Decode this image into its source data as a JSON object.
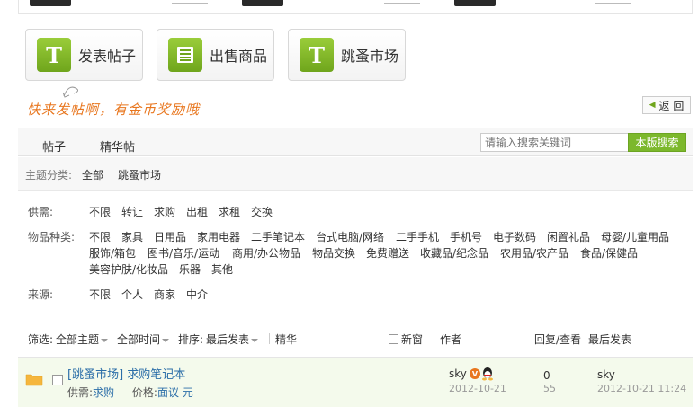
{
  "actions": {
    "post": "发表帖子",
    "sell": "出售商品",
    "market": "跳蚤市场"
  },
  "slogan": "快来发帖啊，有金币奖励哦",
  "back_label": "返 回",
  "tabs": [
    "帖子",
    "精华帖"
  ],
  "search": {
    "placeholder": "请输入搜索关键词",
    "button": "本版搜索"
  },
  "category": {
    "label": "主题分类:",
    "items": [
      "全部",
      "跳蚤市场"
    ]
  },
  "filters": {
    "supply": {
      "label": "供需:",
      "options": [
        "不限",
        "转让",
        "求购",
        "出租",
        "求租",
        "交换"
      ]
    },
    "goods": {
      "label": "物品种类:",
      "row1": [
        "不限",
        "家具",
        "日用品",
        "家用电器",
        "二手笔记本",
        "台式电脑/网络",
        "二手手机",
        "手机号",
        "电子数码",
        "闲置礼品",
        "母婴/儿童用品"
      ],
      "row2": [
        "服饰/箱包",
        "图书/音乐/运动",
        "商用/办公物品",
        "物品交换",
        "免费赠送",
        "收藏品/纪念品",
        "农用品/农产品",
        "食品/保健品"
      ],
      "row3": [
        "美容护肤/化妆品",
        "乐器",
        "其他"
      ]
    },
    "source": {
      "label": "来源:",
      "options": [
        "不限",
        "个人",
        "商家",
        "中介"
      ]
    }
  },
  "list_header": {
    "filter": "筛选:",
    "all_topics": "全部主题",
    "all_time": "全部时间",
    "sort": "排序:",
    "latest": "最后发表",
    "digest": "精华",
    "new_window": "新窗",
    "author": "作者",
    "reply_view": "回复/查看",
    "last_post": "最后发表"
  },
  "threads": [
    {
      "board": "[跳蚤市场]",
      "title": "求购笔记本",
      "supply_label": "供需:",
      "supply_value": "求购",
      "price_label": "价格:",
      "price_value": "面议 元",
      "author": "sky",
      "date": "2012-10-21",
      "replies": "0",
      "views": "55",
      "last_user": "sky",
      "last_time": "2012-10-21 11:24"
    }
  ],
  "colors": {
    "accent_green": "#7cb82c",
    "slogan_orange": "#e8761e",
    "link_blue": "#2b6ea8"
  }
}
